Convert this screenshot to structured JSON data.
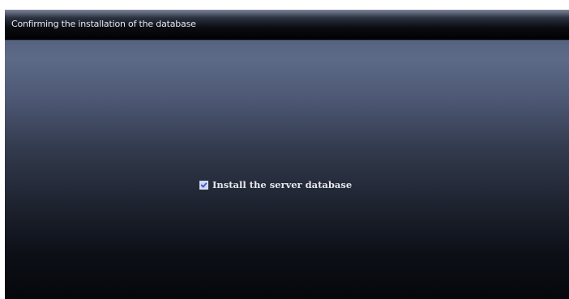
{
  "window": {
    "title": "Confirming the installation of the database"
  },
  "options": {
    "install_server_database": {
      "label": "Install the server database",
      "checked": true
    }
  },
  "colors": {
    "checkbox_check": "#2b4fd8",
    "title_text": "#e8eaf0",
    "label_text": "#e6e8ee"
  },
  "icons": {
    "checkbox": "checkmark-icon"
  }
}
